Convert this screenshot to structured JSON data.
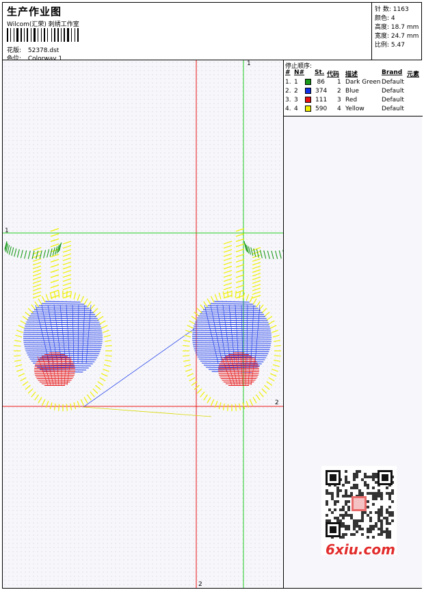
{
  "header": {
    "title": "生产作业图",
    "company": "Wilcom(汇荣) 刺绣工作室",
    "design_label": "花版:",
    "design_value": "52378.dst",
    "colorway_label": "色位:",
    "colorway_value": "Colorway 1"
  },
  "stats": {
    "stitches_label": "针 数:",
    "stitches": "1163",
    "colors_label": "颜色:",
    "colors": "4",
    "height_label": "高度:",
    "height": "18.7 mm",
    "width_label": "宽度:",
    "width": "24.7 mm",
    "scale_label": "比例:",
    "scale": "5.47"
  },
  "canvas": {
    "axis_top": "1",
    "axis_left": "1",
    "axis_right": "2",
    "axis_bottom": "2"
  },
  "stop_sequence": {
    "title": "停止顺序:",
    "columns": [
      "#",
      "N#",
      "St.",
      "代码",
      "描述",
      "Brand",
      "元素"
    ],
    "rows": [
      {
        "idx": "1.",
        "n": "1",
        "color": "#1a9a1a",
        "st": "86",
        "code": "1",
        "desc": "Dark Green",
        "brand": "Default"
      },
      {
        "idx": "2.",
        "n": "2",
        "color": "#1030e8",
        "st": "374",
        "code": "2",
        "desc": "Blue",
        "brand": "Default"
      },
      {
        "idx": "3.",
        "n": "3",
        "color": "#e81010",
        "st": "111",
        "code": "3",
        "desc": "Red",
        "brand": "Default"
      },
      {
        "idx": "4.",
        "n": "4",
        "color": "#f0f000",
        "st": "590",
        "code": "4",
        "desc": "Yellow",
        "brand": "Default"
      }
    ]
  },
  "watermark": {
    "brand": "6xiu.com"
  }
}
